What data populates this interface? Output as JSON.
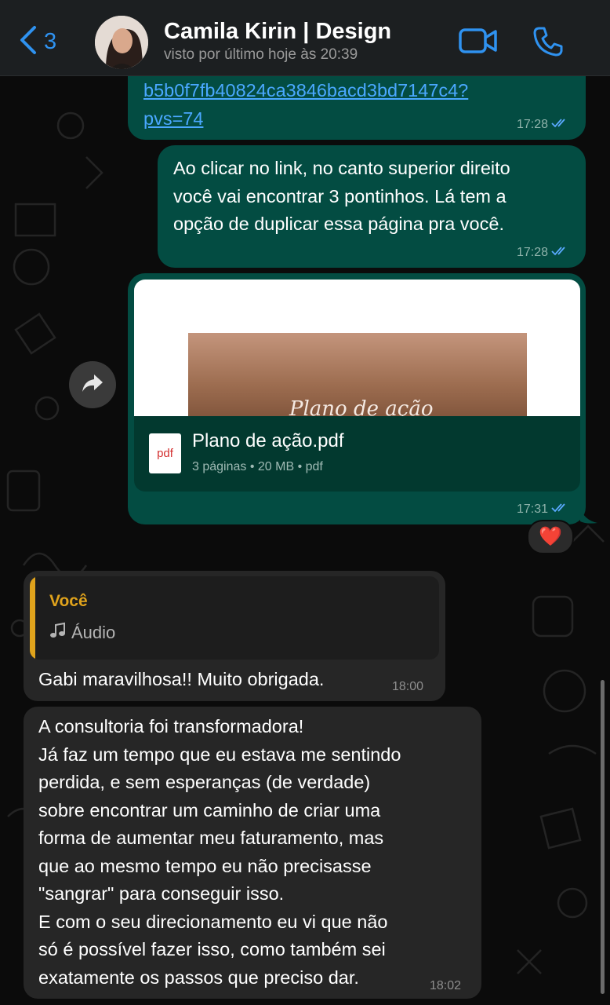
{
  "header": {
    "back_count": "3",
    "contact_name": "Camila Kirin | Design",
    "status": "visto por último hoje às 20:39",
    "icons": [
      "chevron-left-icon",
      "video-call-icon",
      "phone-icon"
    ]
  },
  "colors": {
    "accent": "#2f92f0",
    "outgoing_bubble": "#034c42",
    "incoming_bubble": "#262626",
    "quote_author": "#e0a31c",
    "link": "#4aa8ff"
  },
  "messages": {
    "link_message": {
      "line1": "b5b0f7fb40824ca3846bacd3bd7147c4?",
      "line2": "pvs=74",
      "time": "17:28"
    },
    "instruction_message": {
      "text": "Ao clicar no link, no canto superior direito\nvocê vai encontrar 3 pontinhos. Lá tem a\nopção de duplicar essa página pra você.",
      "time": "17:28"
    },
    "document_message": {
      "preview_title": "Plano de ação",
      "file_name": "Plano de ação.pdf",
      "file_type_badge": "pdf",
      "meta": "3 páginas • 20 MB • pdf",
      "time": "17:31",
      "reaction": "❤️"
    },
    "reply_message": {
      "quote_author": "Você",
      "quote_content": "Áudio",
      "text": "Gabi maravilhosa!! Muito obrigada.",
      "time": "18:00"
    },
    "testimonial_message": {
      "text": "A consultoria foi transformadora!\nJá faz um tempo que eu estava me sentindo\nperdida, e sem esperanças (de verdade)\nsobre encontrar um caminho de criar uma\nforma de aumentar meu faturamento, mas\nque ao mesmo tempo eu não precisasse\n\"sangrar\" para conseguir isso.\nE com o seu direcionamento eu vi que não\nsó é possível fazer isso, como também sei\nexatamente os passos que preciso dar.",
      "time": "18:02"
    }
  }
}
